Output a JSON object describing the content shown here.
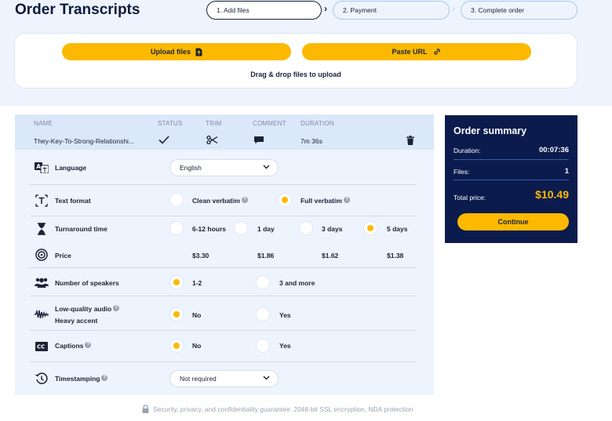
{
  "page": {
    "title": "Order Transcripts"
  },
  "steps": [
    {
      "label": "1. Add files"
    },
    {
      "label": "2. Payment"
    },
    {
      "label": "3. Complete order"
    }
  ],
  "upload": {
    "upload_label": "Upload files",
    "paste_label": "Paste URL",
    "drag_text": "Drag & drop files to upload"
  },
  "file_table": {
    "headers": {
      "name": "NAME",
      "status": "STATUS",
      "trim": "TRIM",
      "comment": "COMMENT",
      "duration": "DURATION"
    },
    "file": {
      "name": "They-Key-To-Strong-Relationshi...",
      "duration": "7m 36s"
    }
  },
  "options": {
    "language": {
      "label": "Language",
      "value": "English"
    },
    "text_format": {
      "label": "Text format",
      "options": [
        "Clean verbatim",
        "Full verbatim"
      ],
      "selected": 1
    },
    "turnaround": {
      "label": "Turnaround time",
      "options": [
        "6-12 hours",
        "1 day",
        "3 days",
        "5 days"
      ],
      "selected": 3
    },
    "price": {
      "label": "Price",
      "values": [
        "$3.30",
        "$1.86",
        "$1.62",
        "$1.38"
      ]
    },
    "speakers": {
      "label": "Number of speakers",
      "options": [
        "1-2",
        "3 and more"
      ],
      "selected": 0
    },
    "low_quality": {
      "label": "Low-quality audio",
      "label2": "Heavy accent",
      "options": [
        "No",
        "Yes"
      ],
      "selected": 0
    },
    "captions": {
      "label": "Captions",
      "options": [
        "No",
        "Yes"
      ],
      "selected": 0
    },
    "timestamping": {
      "label": "Timestamping",
      "value": "Not required"
    }
  },
  "summary": {
    "title": "Order summary",
    "duration_label": "Duration:",
    "duration_value": "00:07:36",
    "files_label": "Files:",
    "files_value": "1",
    "total_label": "Total price:",
    "total_value": "$10.49",
    "continue_label": "Continue"
  },
  "footer": {
    "note": "Security, privacy, and confidentiality guarantee: 2048-bit SSL encryption, NDA protection"
  },
  "colors": {
    "accent": "#fcb900",
    "navy": "#0b1b4d",
    "panel": "#edf4fd",
    "header": "#dbe8fa"
  }
}
